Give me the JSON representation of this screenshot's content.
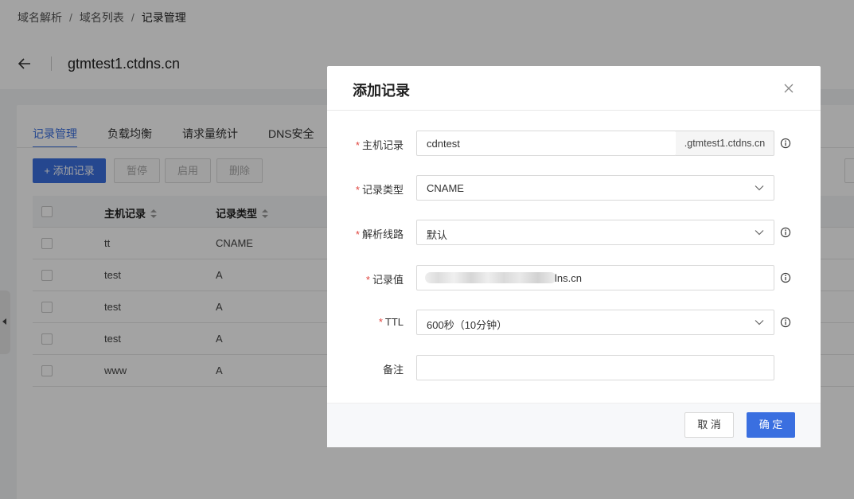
{
  "breadcrumb": [
    "域名解析",
    "域名列表",
    "记录管理"
  ],
  "breadcrumb_sep": "/",
  "domain": "gtmtest1.ctdns.cn",
  "tabs": [
    "记录管理",
    "负载均衡",
    "请求量统计",
    "DNS安全"
  ],
  "toolbar": {
    "add": "+ 添加记录",
    "pause": "暂停",
    "enable": "启用",
    "delete": "删除"
  },
  "table": {
    "headers": [
      "主机记录",
      "记录类型"
    ],
    "rows": [
      {
        "host": "tt",
        "type": "CNAME"
      },
      {
        "host": "test",
        "type": "A"
      },
      {
        "host": "test",
        "type": "A"
      },
      {
        "host": "test",
        "type": "A"
      },
      {
        "host": "www",
        "type": "A"
      }
    ]
  },
  "modal": {
    "title": "添加记录",
    "fields": {
      "host": {
        "label": "主机记录",
        "value": "cdntest",
        "suffix": ".gtmtest1.ctdns.cn"
      },
      "type": {
        "label": "记录类型",
        "value": "CNAME"
      },
      "line": {
        "label": "解析线路",
        "value": "默认"
      },
      "record_value": {
        "label": "记录值",
        "value_visible_tail": "lns.cn"
      },
      "ttl": {
        "label": "TTL",
        "value": "600秒（10分钟）"
      },
      "remark": {
        "label": "备注",
        "value": ""
      }
    },
    "required_mark": "*",
    "cancel": "取 消",
    "ok": "确 定"
  },
  "colors": {
    "primary": "#3a6fe0",
    "required": "#e0443e",
    "overlay": "rgba(0,0,0,0.36)"
  },
  "icons": [
    "back-arrow-icon",
    "sort-icon",
    "close-icon",
    "chevron-down-icon",
    "info-icon",
    "collapse-arrow-icon"
  ]
}
